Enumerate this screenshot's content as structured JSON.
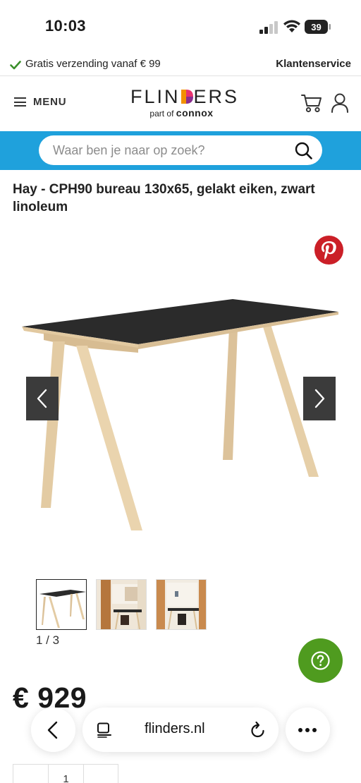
{
  "status_bar": {
    "time": "10:03",
    "battery": "39"
  },
  "promo": {
    "text": "Gratis verzending vanaf € 99",
    "service": "Klantenservice"
  },
  "header": {
    "menu_label": "MENU",
    "logo_part1": "FLIN",
    "logo_part2": "ERS",
    "logo_sub_prefix": "part of ",
    "logo_sub_brand": "connox"
  },
  "search": {
    "placeholder": "Waar ben je naar op zoek?"
  },
  "product": {
    "title": "Hay - CPH90 bureau 130x65, gelakt eiken, zwart linoleum",
    "image_counter": "1 / 3",
    "price": "€ 929",
    "quantity": "1"
  },
  "browser": {
    "url": "flinders.nl"
  },
  "colors": {
    "search_band": "#1fa1dc",
    "help_button": "#4f9b1f",
    "pinterest": "#cb1f27",
    "gallery_arrow": "#3b3b3b"
  }
}
